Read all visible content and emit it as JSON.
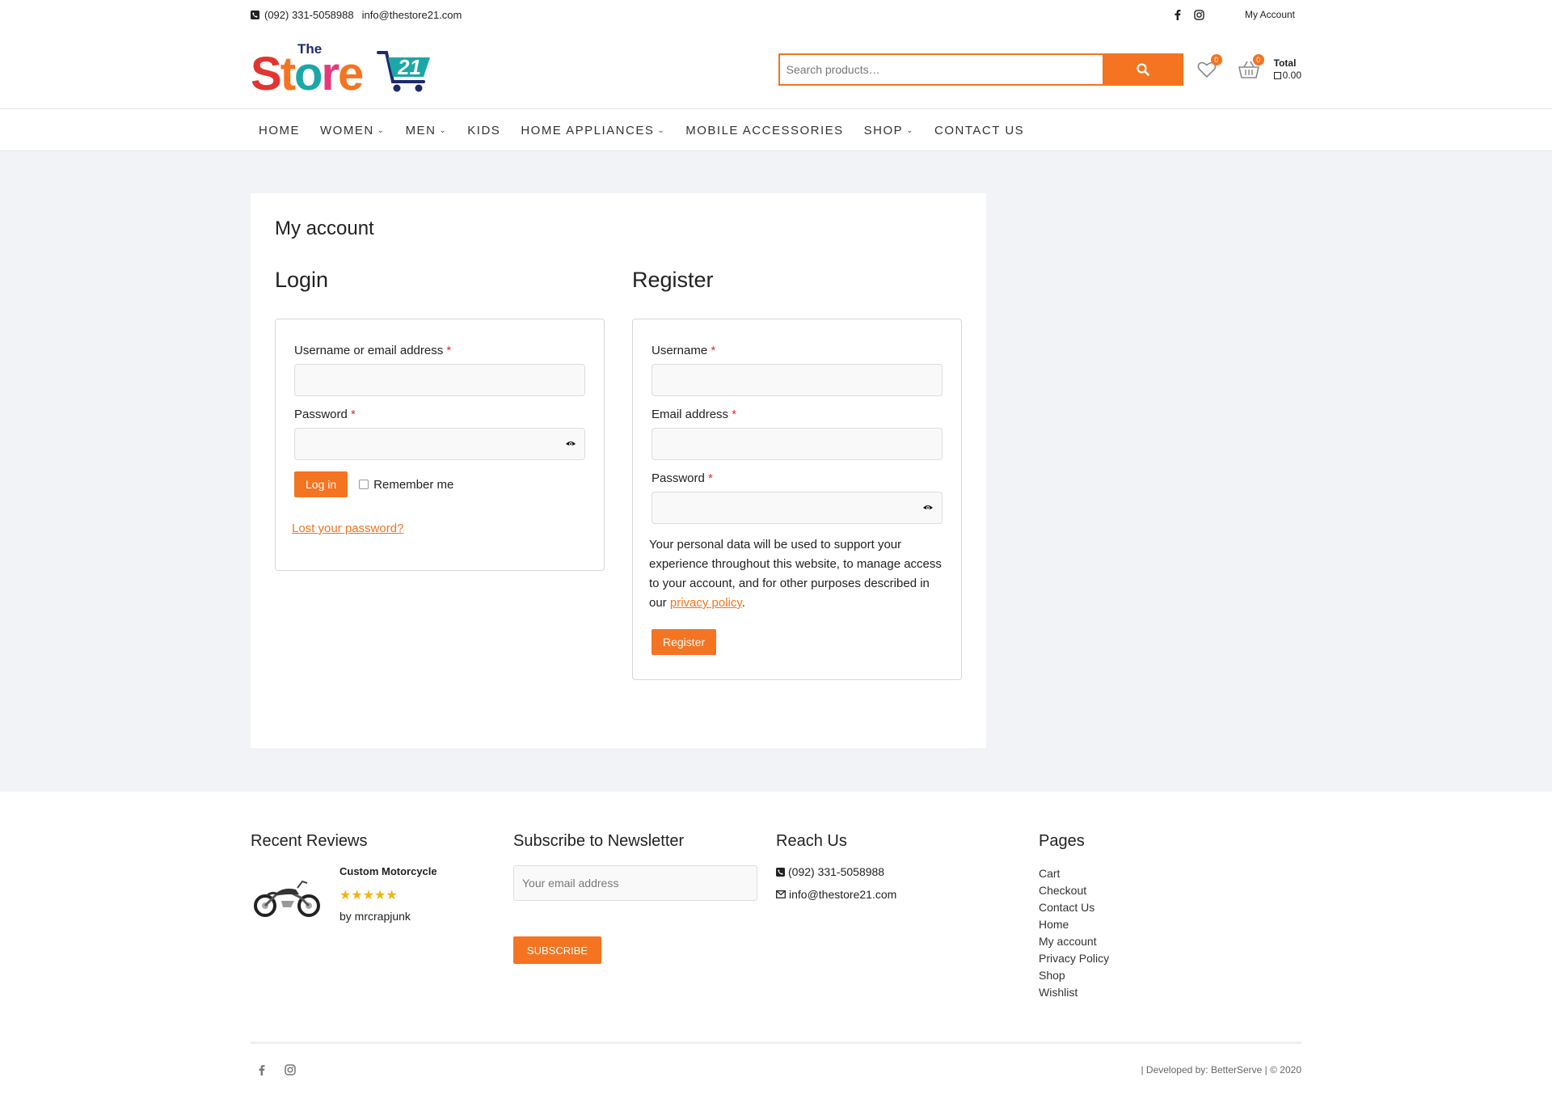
{
  "topbar": {
    "phone": "(092) 331-5058988",
    "email": "info@thestore21.com",
    "account": "My Account",
    "icons": [
      "phone-square-icon",
      "facebook-icon",
      "instagram-icon"
    ]
  },
  "header": {
    "logo_small": "The",
    "logo_word": "Store",
    "logo_number": "21",
    "search_placeholder": "Search products…",
    "wishlist_count": "0",
    "cart_count": "0",
    "total_label": "Total",
    "total_amount": "0.00"
  },
  "nav": {
    "items": [
      {
        "label": "HOME"
      },
      {
        "label": "WOMEN"
      },
      {
        "label": "MEN"
      },
      {
        "label": "KIDS"
      },
      {
        "label": "HOME APPLIANCES"
      },
      {
        "label": "MOBILE ACCESSORIES"
      },
      {
        "label": "SHOP"
      },
      {
        "label": "CONTACT US"
      }
    ]
  },
  "page": {
    "title": "My account",
    "login": {
      "heading": "Login",
      "username_label": "Username or email address",
      "password_label": "Password",
      "required": "*",
      "button": "Log in",
      "remember": "Remember me",
      "lost": "Lost your password?"
    },
    "register": {
      "heading": "Register",
      "username_label": "Username",
      "email_label": "Email address",
      "password_label": "Password",
      "required": "*",
      "privacy_text": "Your personal data will be used to support your experience throughout this website, to manage access to your account, and for other purposes described in our ",
      "privacy_link": "privacy policy",
      "privacy_end": ".",
      "button": "Register"
    }
  },
  "footer": {
    "reviews": {
      "heading": "Recent Reviews",
      "product": "Custom Motorcycle",
      "rating": 5,
      "stars": "★★★★★",
      "author": "by mrcrapjunk"
    },
    "newsletter": {
      "heading": "Subscribe to Newsletter",
      "placeholder": "Your email address",
      "button": "SUBSCRIBE"
    },
    "reach": {
      "heading": "Reach Us",
      "phone": "(092) 331-5058988",
      "email": "info@thestore21.com"
    },
    "pages": {
      "heading": "Pages",
      "links": [
        "Cart",
        "Checkout",
        "Contact Us",
        "Home",
        "My account",
        "Privacy Policy",
        "Shop",
        "Wishlist"
      ]
    },
    "credit": "| Developed by: BetterServe | © 2020"
  },
  "colors": {
    "accent": "#f47421",
    "background": "#f2f3f7",
    "required": "#e3282c"
  }
}
